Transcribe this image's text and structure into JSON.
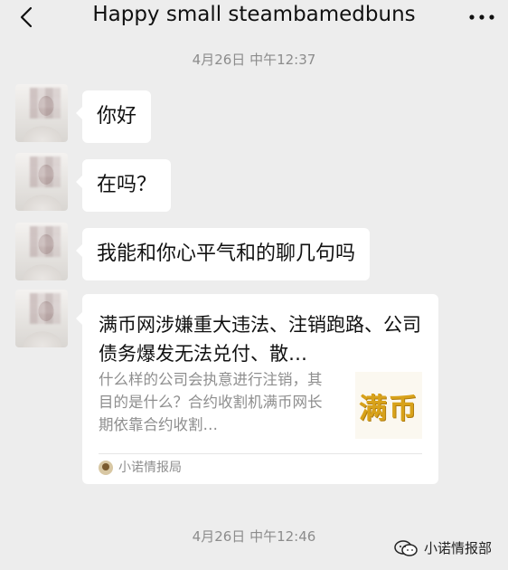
{
  "header": {
    "title": "Happy small steambamedbuns",
    "back_icon": "chevron-left-icon",
    "more_icon": "more-dots-icon"
  },
  "timestamps": {
    "first": "4月26日 中午12:37",
    "second": "4月26日 中午12:46"
  },
  "messages": [
    {
      "text": "你好"
    },
    {
      "text": "在吗？"
    },
    {
      "text": "我能和你心平气和的聊几句吗"
    }
  ],
  "link_card": {
    "title": "满币网涉嫌重大违法、注销跑路、公司债务爆发无法兑付、散…",
    "description": "什么样的公司会执意进行注销，其目的是什么？合约收割机满币网长期依靠合约收割…",
    "thumb_text": "满币",
    "source": "小诺情报局"
  },
  "watermark": {
    "text": "小诺情报部"
  },
  "colors": {
    "background": "#ededed",
    "bubble": "#ffffff",
    "secondary_text": "#8e8e8e",
    "thumb_gold": "#d8a21a"
  }
}
